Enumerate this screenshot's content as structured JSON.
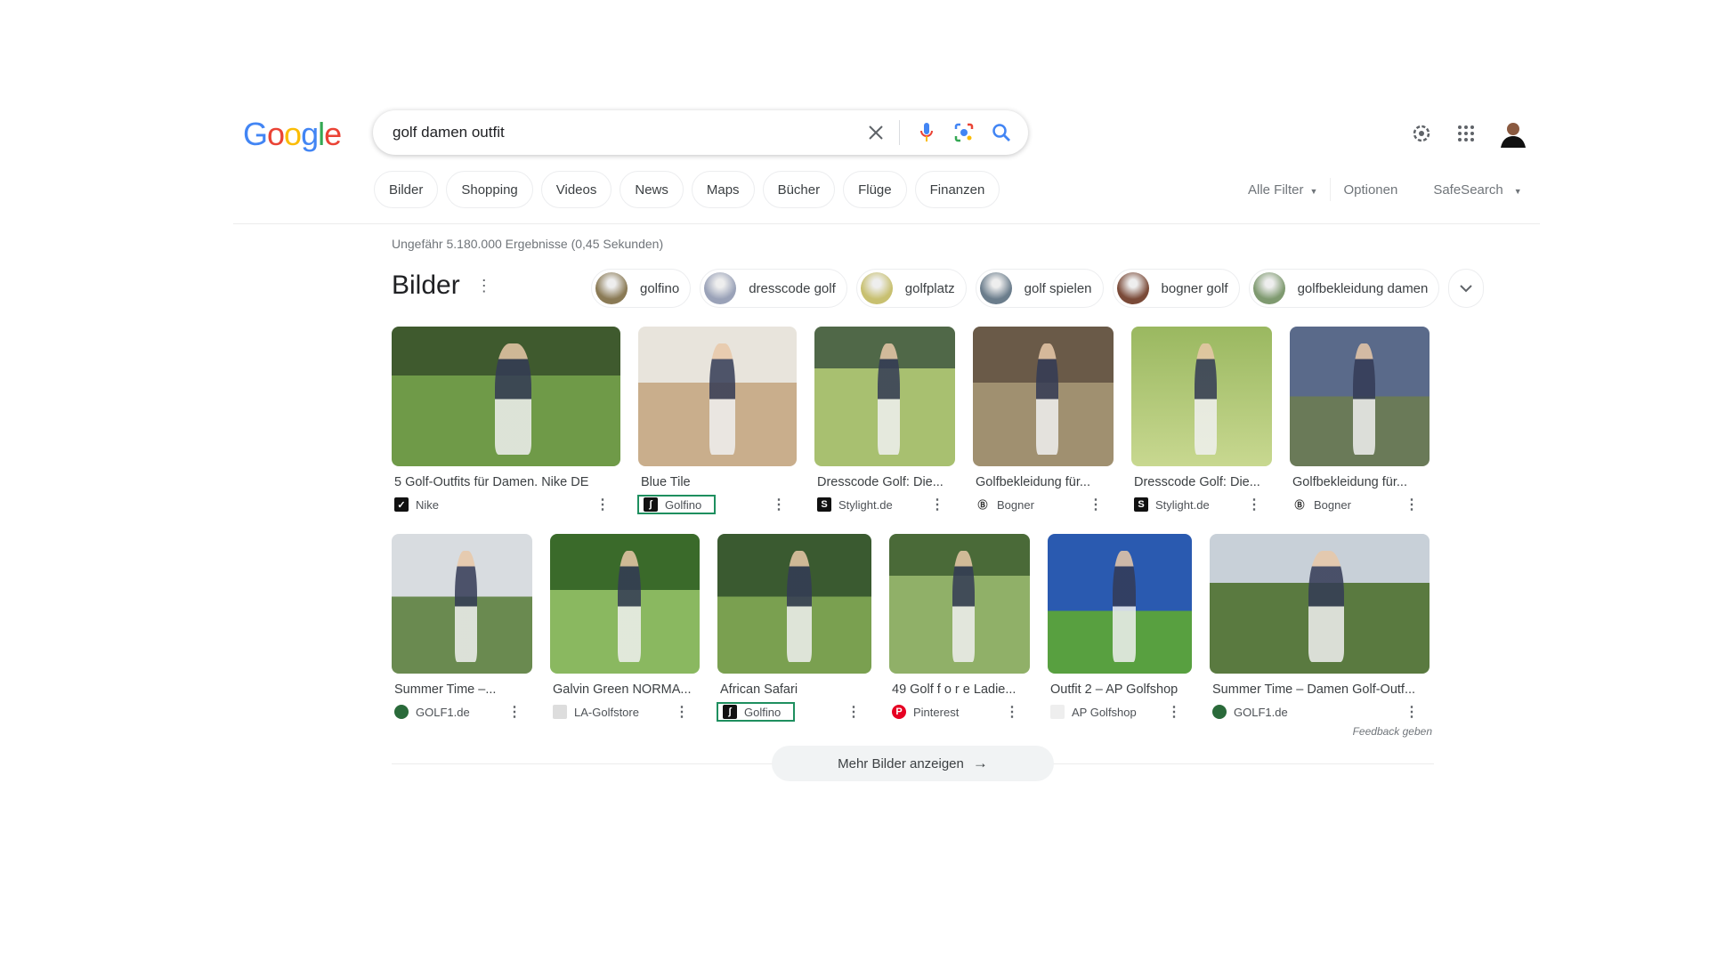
{
  "logo": "Google",
  "search": {
    "value": "golf damen outfit"
  },
  "tabs": [
    "Bilder",
    "Shopping",
    "Videos",
    "News",
    "Maps",
    "Bücher",
    "Flüge",
    "Finanzen"
  ],
  "filters": {
    "all": "Alle Filter",
    "options": "Optionen",
    "safesearch": "SafeSearch"
  },
  "stats": "Ungefähr 5.180.000 Ergebnisse (0,45 Sekunden)",
  "section_title": "Bilder",
  "related": [
    "golfino",
    "dresscode golf",
    "golfplatz",
    "golf spielen",
    "bogner golf",
    "golfbekleidung damen"
  ],
  "row1": [
    {
      "title": "5 Golf-Outfits für Damen. Nike DE",
      "source": "Nike",
      "icon": "nike-icon"
    },
    {
      "title": "Blue Tile",
      "source": "Golfino",
      "icon": "golfino-icon",
      "highlighted": true
    },
    {
      "title": "Dresscode Golf: Die...",
      "source": "Stylight.de",
      "icon": "stylight-icon"
    },
    {
      "title": "Golfbekleidung für...",
      "source": "Bogner",
      "icon": "bogner-icon"
    },
    {
      "title": "Dresscode Golf: Die...",
      "source": "Stylight.de",
      "icon": "stylight-icon"
    },
    {
      "title": "Golfbekleidung für...",
      "source": "Bogner",
      "icon": "bogner-icon"
    }
  ],
  "row2": [
    {
      "title": "Summer Time –...",
      "source": "GOLF1.de",
      "icon": "golf1-icon"
    },
    {
      "title": "Galvin Green NORMA...",
      "source": "LA-Golfstore",
      "icon": "la-golfstore-icon"
    },
    {
      "title": "African Safari",
      "source": "Golfino",
      "icon": "golfino-icon",
      "highlighted": true
    },
    {
      "title": "49 Golf f o r e Ladie...",
      "source": "Pinterest",
      "icon": "pinterest-icon"
    },
    {
      "title": "Outfit 2 – AP Golfshop",
      "source": "AP Golfshop",
      "icon": "ap-golfshop-icon"
    },
    {
      "title": "Summer Time – Damen Golf-Outf...",
      "source": "GOLF1.de",
      "icon": "golf1-icon"
    }
  ],
  "feedback": "Feedback geben",
  "more_button": "Mehr Bilder anzeigen",
  "colors": {
    "highlight": "#1e8f5f",
    "accent": "#4285f4"
  }
}
